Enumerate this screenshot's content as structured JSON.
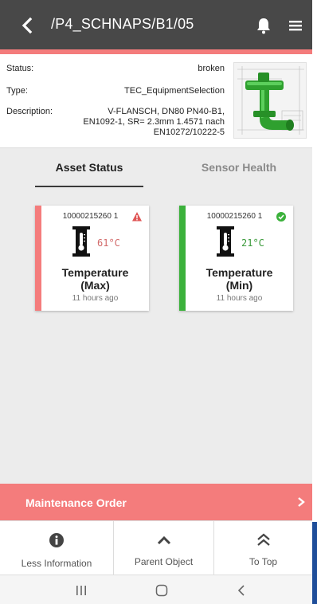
{
  "header": {
    "title": "/P4_SCHNAPS/B1/05",
    "back_icon": "chevron-left-icon",
    "bell_icon": "bell-icon",
    "menu_icon": "hamburger-menu-icon"
  },
  "info": {
    "status_label": "Status:",
    "status_value": "broken",
    "type_label": "Type:",
    "type_value": "TEC_EquipmentSelection",
    "description_label": "Description:",
    "description_line1": "V-FLANSCH, DN80 PN40-B1,",
    "description_line2": "EN1092-1, SR= 2.3mm 1.4571 nach",
    "description_line3": "EN10272/10222-5"
  },
  "tabs": [
    {
      "label": "Asset Status",
      "active": true
    },
    {
      "label": "Sensor Health",
      "active": false
    }
  ],
  "cards": [
    {
      "id": "10000215260 1",
      "temperature": "61°C",
      "label_line1": "Temperature",
      "label_line2": "(Max)",
      "time": "11 hours ago",
      "status_icon": "warning-triangle-icon"
    },
    {
      "id": "10000215260 1",
      "temperature": "21°C",
      "label_line1": "Temperature",
      "label_line2": "(Min)",
      "time": "11 hours ago",
      "status_icon": "check-circle-icon"
    }
  ],
  "maintenance": {
    "label": "Maintenance Order",
    "icon": "chevron-right-icon"
  },
  "bottom_nav": [
    {
      "label": "Less Information",
      "icon": "info-circle-icon"
    },
    {
      "label": "Parent Object",
      "icon": "chevron-up-icon"
    },
    {
      "label": "To Top",
      "icon": "double-chevron-up-icon"
    }
  ],
  "colors": {
    "header": "#484848",
    "accent": "#f47c7c",
    "ok": "#3bb13b",
    "alert_icon": "#e05555"
  }
}
